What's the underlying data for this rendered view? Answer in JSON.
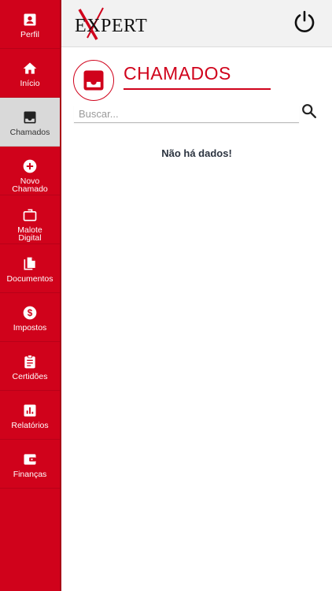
{
  "brand": {
    "logo_text": "EXPERT"
  },
  "sidebar": {
    "items": [
      {
        "label": "Perfil",
        "icon": "person-icon"
      },
      {
        "label": "Início",
        "icon": "home-icon"
      },
      {
        "label": "Chamados",
        "icon": "inbox-icon",
        "active": true
      },
      {
        "label": "Novo\nChamado",
        "icon": "add-circle-icon"
      },
      {
        "label": "Malote\nDigital",
        "icon": "briefcase-icon"
      },
      {
        "label": "Documentos",
        "icon": "documents-icon"
      },
      {
        "label": "Impostos",
        "icon": "dollar-icon"
      },
      {
        "label": "Certidões",
        "icon": "clipboard-icon"
      },
      {
        "label": "Relatórios",
        "icon": "bar-chart-icon"
      },
      {
        "label": "Finanças",
        "icon": "wallet-icon"
      }
    ]
  },
  "header": {
    "title": "CHAMADOS",
    "icon": "inbox-icon"
  },
  "search": {
    "placeholder": "Buscar...",
    "value": ""
  },
  "empty_state": {
    "message": "Não há dados!"
  },
  "colors": {
    "primary": "#d0021b",
    "active_bg": "#d9d9d9",
    "text_dark": "#2c3440"
  }
}
